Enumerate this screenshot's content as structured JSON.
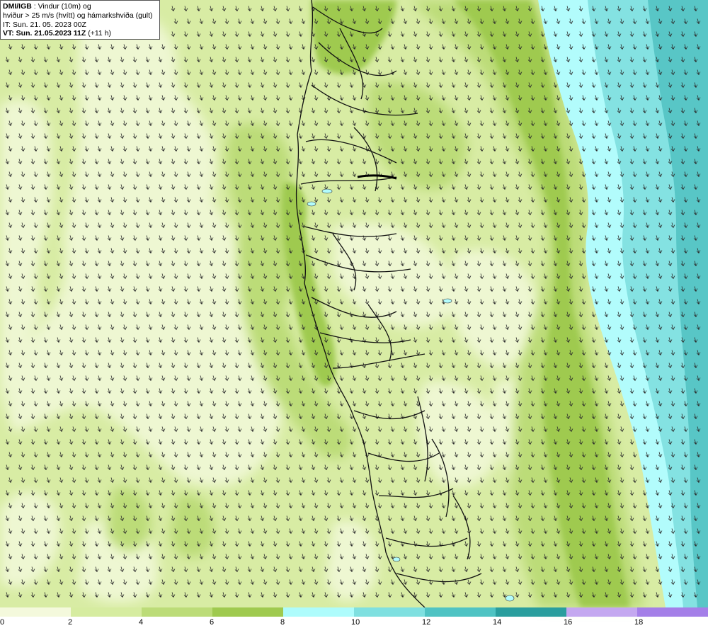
{
  "header": {
    "org": "DMI/IGB",
    "title_rest": " : Vindur (10m) og",
    "line2": "hviður > 25 m/s (hvítt) og hámarkshviða (gult)",
    "it_line": "IT: Sun. 21. 05. 2023 00Z",
    "vt_bold": "VT: Sun. 21.05.2023 11Z",
    "vt_suffix": " (+11 h)"
  },
  "legend": {
    "ticks": [
      "0",
      "2",
      "4",
      "6",
      "8",
      "10",
      "12",
      "14",
      "16",
      "18"
    ],
    "colors": [
      "#f4f9dc",
      "#d6eca0",
      "#bcdc78",
      "#9fca4f",
      "#aefcfc",
      "#7fe0e0",
      "#4fc3c3",
      "#2a9e9e",
      "#c4a8f0",
      "#a47fe8"
    ]
  },
  "map": {
    "wind_arrow_direction": "south-southeast",
    "colors": {
      "ocean_calm": "#eef7d2",
      "light": "#d8eca4",
      "medium": "#bcdc78",
      "strong": "#9fca4f",
      "cyan_light": "#b2fcfc",
      "cyan": "#84e2e2",
      "teal": "#58c6c6",
      "coast_line": "#111111",
      "arrow": "#2b2b2b"
    }
  }
}
